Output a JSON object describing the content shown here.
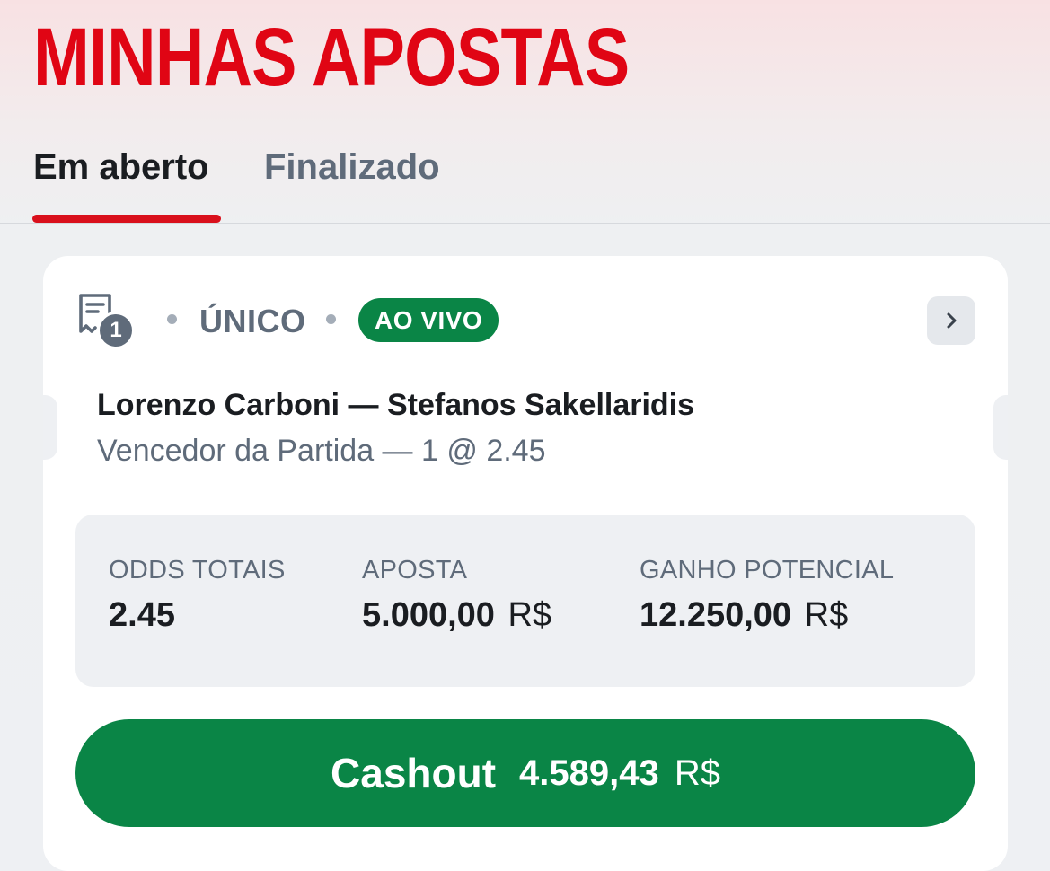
{
  "header": {
    "title": "MINHAS APOSTAS"
  },
  "tabs": [
    {
      "label": "Em aberto",
      "active": true
    },
    {
      "label": "Finalizado",
      "active": false
    }
  ],
  "bet": {
    "selections_count": "1",
    "type": "ÚNICO",
    "live_badge": "AO VIVO",
    "match": "Lorenzo Carboni — Stefanos Sakellaridis",
    "market": "Vencedor da Partida — 1 @ 2.45",
    "summary": {
      "odds_label": "ODDS TOTAIS",
      "odds_value": "2.45",
      "stake_label": "APOSTA",
      "stake_value": "5.000,00",
      "stake_currency": "R$",
      "win_label": "GANHO POTENCIAL",
      "win_value": "12.250,00",
      "win_currency": "R$"
    },
    "cashout": {
      "label": "Cashout",
      "amount": "4.589,43",
      "currency": "R$"
    }
  },
  "icons": {
    "ticket": "bet-slip-icon",
    "expand": "chevron-right-icon"
  },
  "colors": {
    "brand_red": "#e00514",
    "live_green": "#0a8546",
    "muted_text": "#5f6b7a"
  }
}
